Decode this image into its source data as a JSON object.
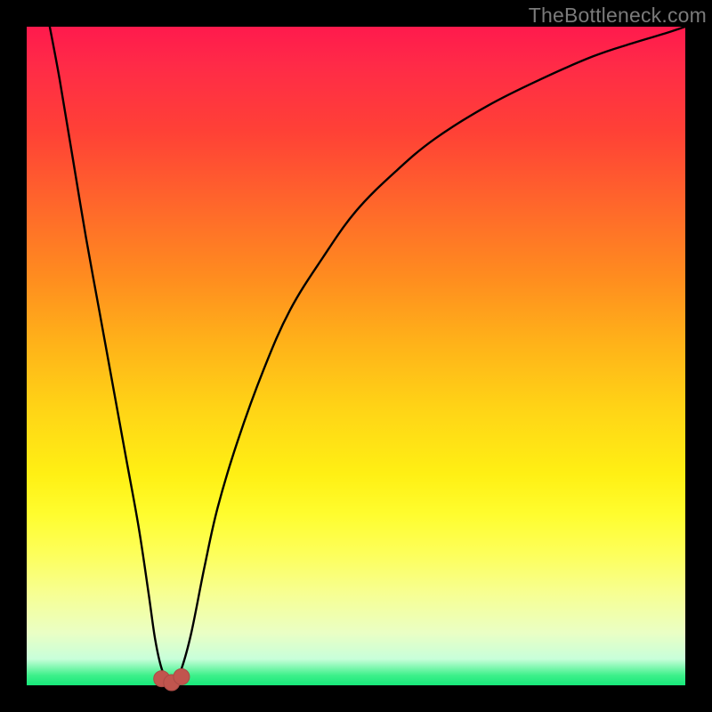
{
  "watermark": "TheBottleneck.com",
  "colors": {
    "frame": "#000000",
    "gradient_top": "#ff1a4d",
    "gradient_bottom": "#17e87a",
    "curve": "#000000",
    "marker_fill": "#c1554e",
    "marker_stroke": "#aa4a45"
  },
  "chart_data": {
    "type": "line",
    "title": "",
    "xlabel": "",
    "ylabel": "",
    "xlim": [
      0,
      100
    ],
    "ylim": [
      0,
      100
    ],
    "grid": false,
    "legend": false,
    "series": [
      {
        "name": "bottleneck-curve",
        "x": [
          3.5,
          5,
          7,
          9,
          11,
          13,
          15,
          17,
          18.5,
          19.5,
          20.5,
          21.5,
          22.5,
          23.5,
          25,
          27,
          29,
          32,
          36,
          40,
          45,
          50,
          56,
          62,
          70,
          78,
          86,
          92,
          97,
          100
        ],
        "y": [
          100,
          92,
          80,
          68,
          57,
          46,
          35,
          24,
          14,
          7,
          2.5,
          0.7,
          0.7,
          2.5,
          8,
          18,
          27,
          37,
          48,
          57,
          65,
          72,
          78,
          83,
          88,
          92,
          95.5,
          97.5,
          99,
          100
        ]
      }
    ],
    "markers": [
      {
        "x": 20.5,
        "y": 1.0
      },
      {
        "x": 22.0,
        "y": 0.4
      },
      {
        "x": 23.5,
        "y": 1.3
      }
    ],
    "optimum_x": 22
  }
}
